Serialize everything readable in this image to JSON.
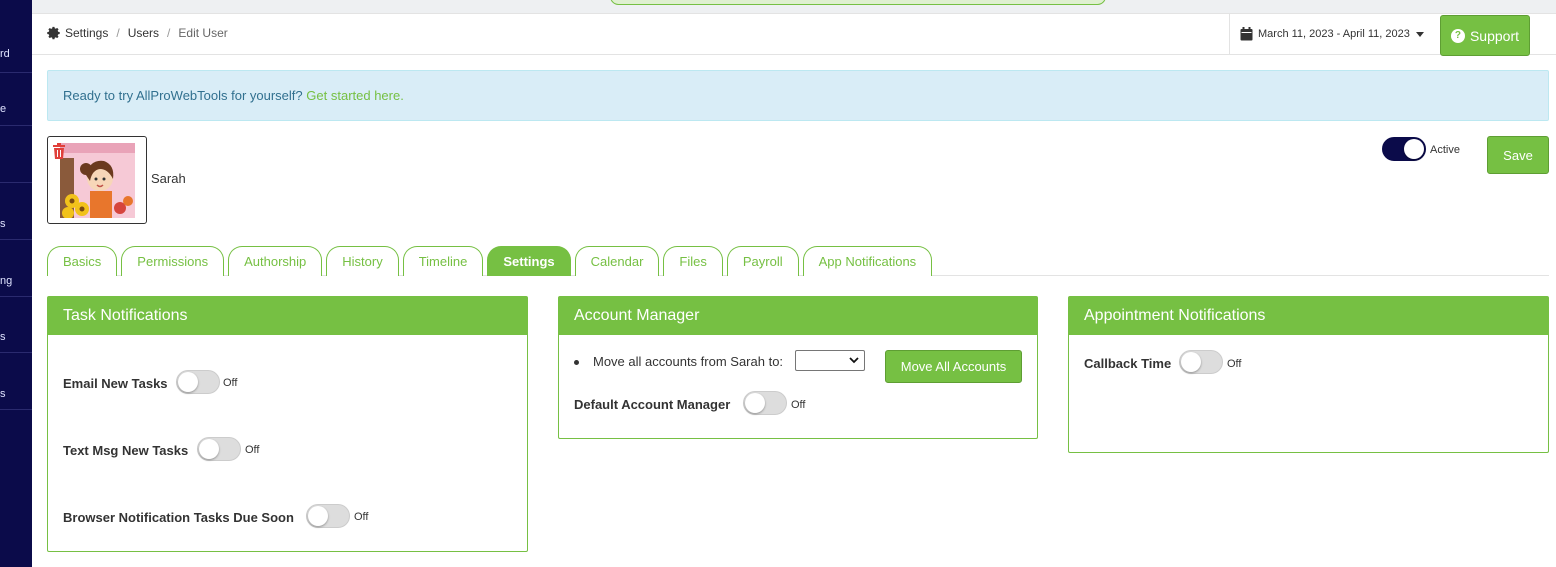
{
  "sidebar": {
    "fragments": [
      "rd",
      "e",
      "s",
      "ng",
      "s",
      "s"
    ]
  },
  "breadcrumb": {
    "settings": "Settings",
    "users": "Users",
    "current": "Edit User"
  },
  "header": {
    "date_range": "March 11, 2023 - April 11, 2023",
    "support_label": "Support"
  },
  "banner": {
    "text": "Ready to try AllProWebTools for yourself?",
    "link": "Get started here."
  },
  "user": {
    "name": "Sarah",
    "status_label": "Active",
    "save_label": "Save"
  },
  "tabs": [
    {
      "label": "Basics"
    },
    {
      "label": "Permissions"
    },
    {
      "label": "Authorship"
    },
    {
      "label": "History"
    },
    {
      "label": "Timeline"
    },
    {
      "label": "Settings",
      "active": true
    },
    {
      "label": "Calendar"
    },
    {
      "label": "Files"
    },
    {
      "label": "Payroll"
    },
    {
      "label": "App Notifications"
    }
  ],
  "task_notifications": {
    "title": "Task Notifications",
    "email_label": "Email New Tasks",
    "email_state": "Off",
    "text_label": "Text Msg New Tasks",
    "text_state": "Off",
    "browser_label": "Browser Notification Tasks Due Soon",
    "browser_state": "Off"
  },
  "account_manager": {
    "title": "Account Manager",
    "move_text": "Move all accounts from Sarah to:",
    "move_button": "Move All Accounts",
    "default_label": "Default Account Manager",
    "default_state": "Off"
  },
  "appointment_notifications": {
    "title": "Appointment Notifications",
    "callback_label": "Callback Time",
    "callback_state": "Off"
  },
  "colors": {
    "brand_green": "#76c043",
    "sidebar_navy": "#0b0b4a",
    "banner_bg": "#d9edf7"
  }
}
